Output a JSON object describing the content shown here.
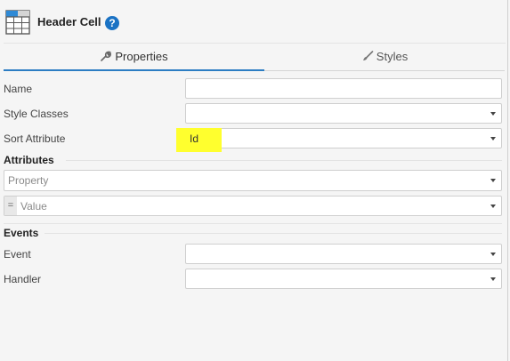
{
  "header": {
    "title": "Header Cell",
    "help": "?"
  },
  "tabs": [
    {
      "label": "Properties",
      "icon": "wrench-icon"
    },
    {
      "label": "Styles",
      "icon": "brush-icon"
    }
  ],
  "fields": {
    "name": {
      "label": "Name",
      "value": ""
    },
    "style_classes": {
      "label": "Style Classes",
      "value": ""
    },
    "sort_attribute": {
      "label": "Sort Attribute",
      "value": "Id"
    }
  },
  "attributes": {
    "title": "Attributes",
    "property_placeholder": "Property",
    "operator": "=",
    "value_placeholder": "Value"
  },
  "events": {
    "title": "Events",
    "event": {
      "label": "Event",
      "value": ""
    },
    "handler": {
      "label": "Handler",
      "value": ""
    }
  },
  "colors": {
    "accent": "#2c7dc3",
    "highlight": "#ffff2e",
    "help": "#1a72c4"
  }
}
